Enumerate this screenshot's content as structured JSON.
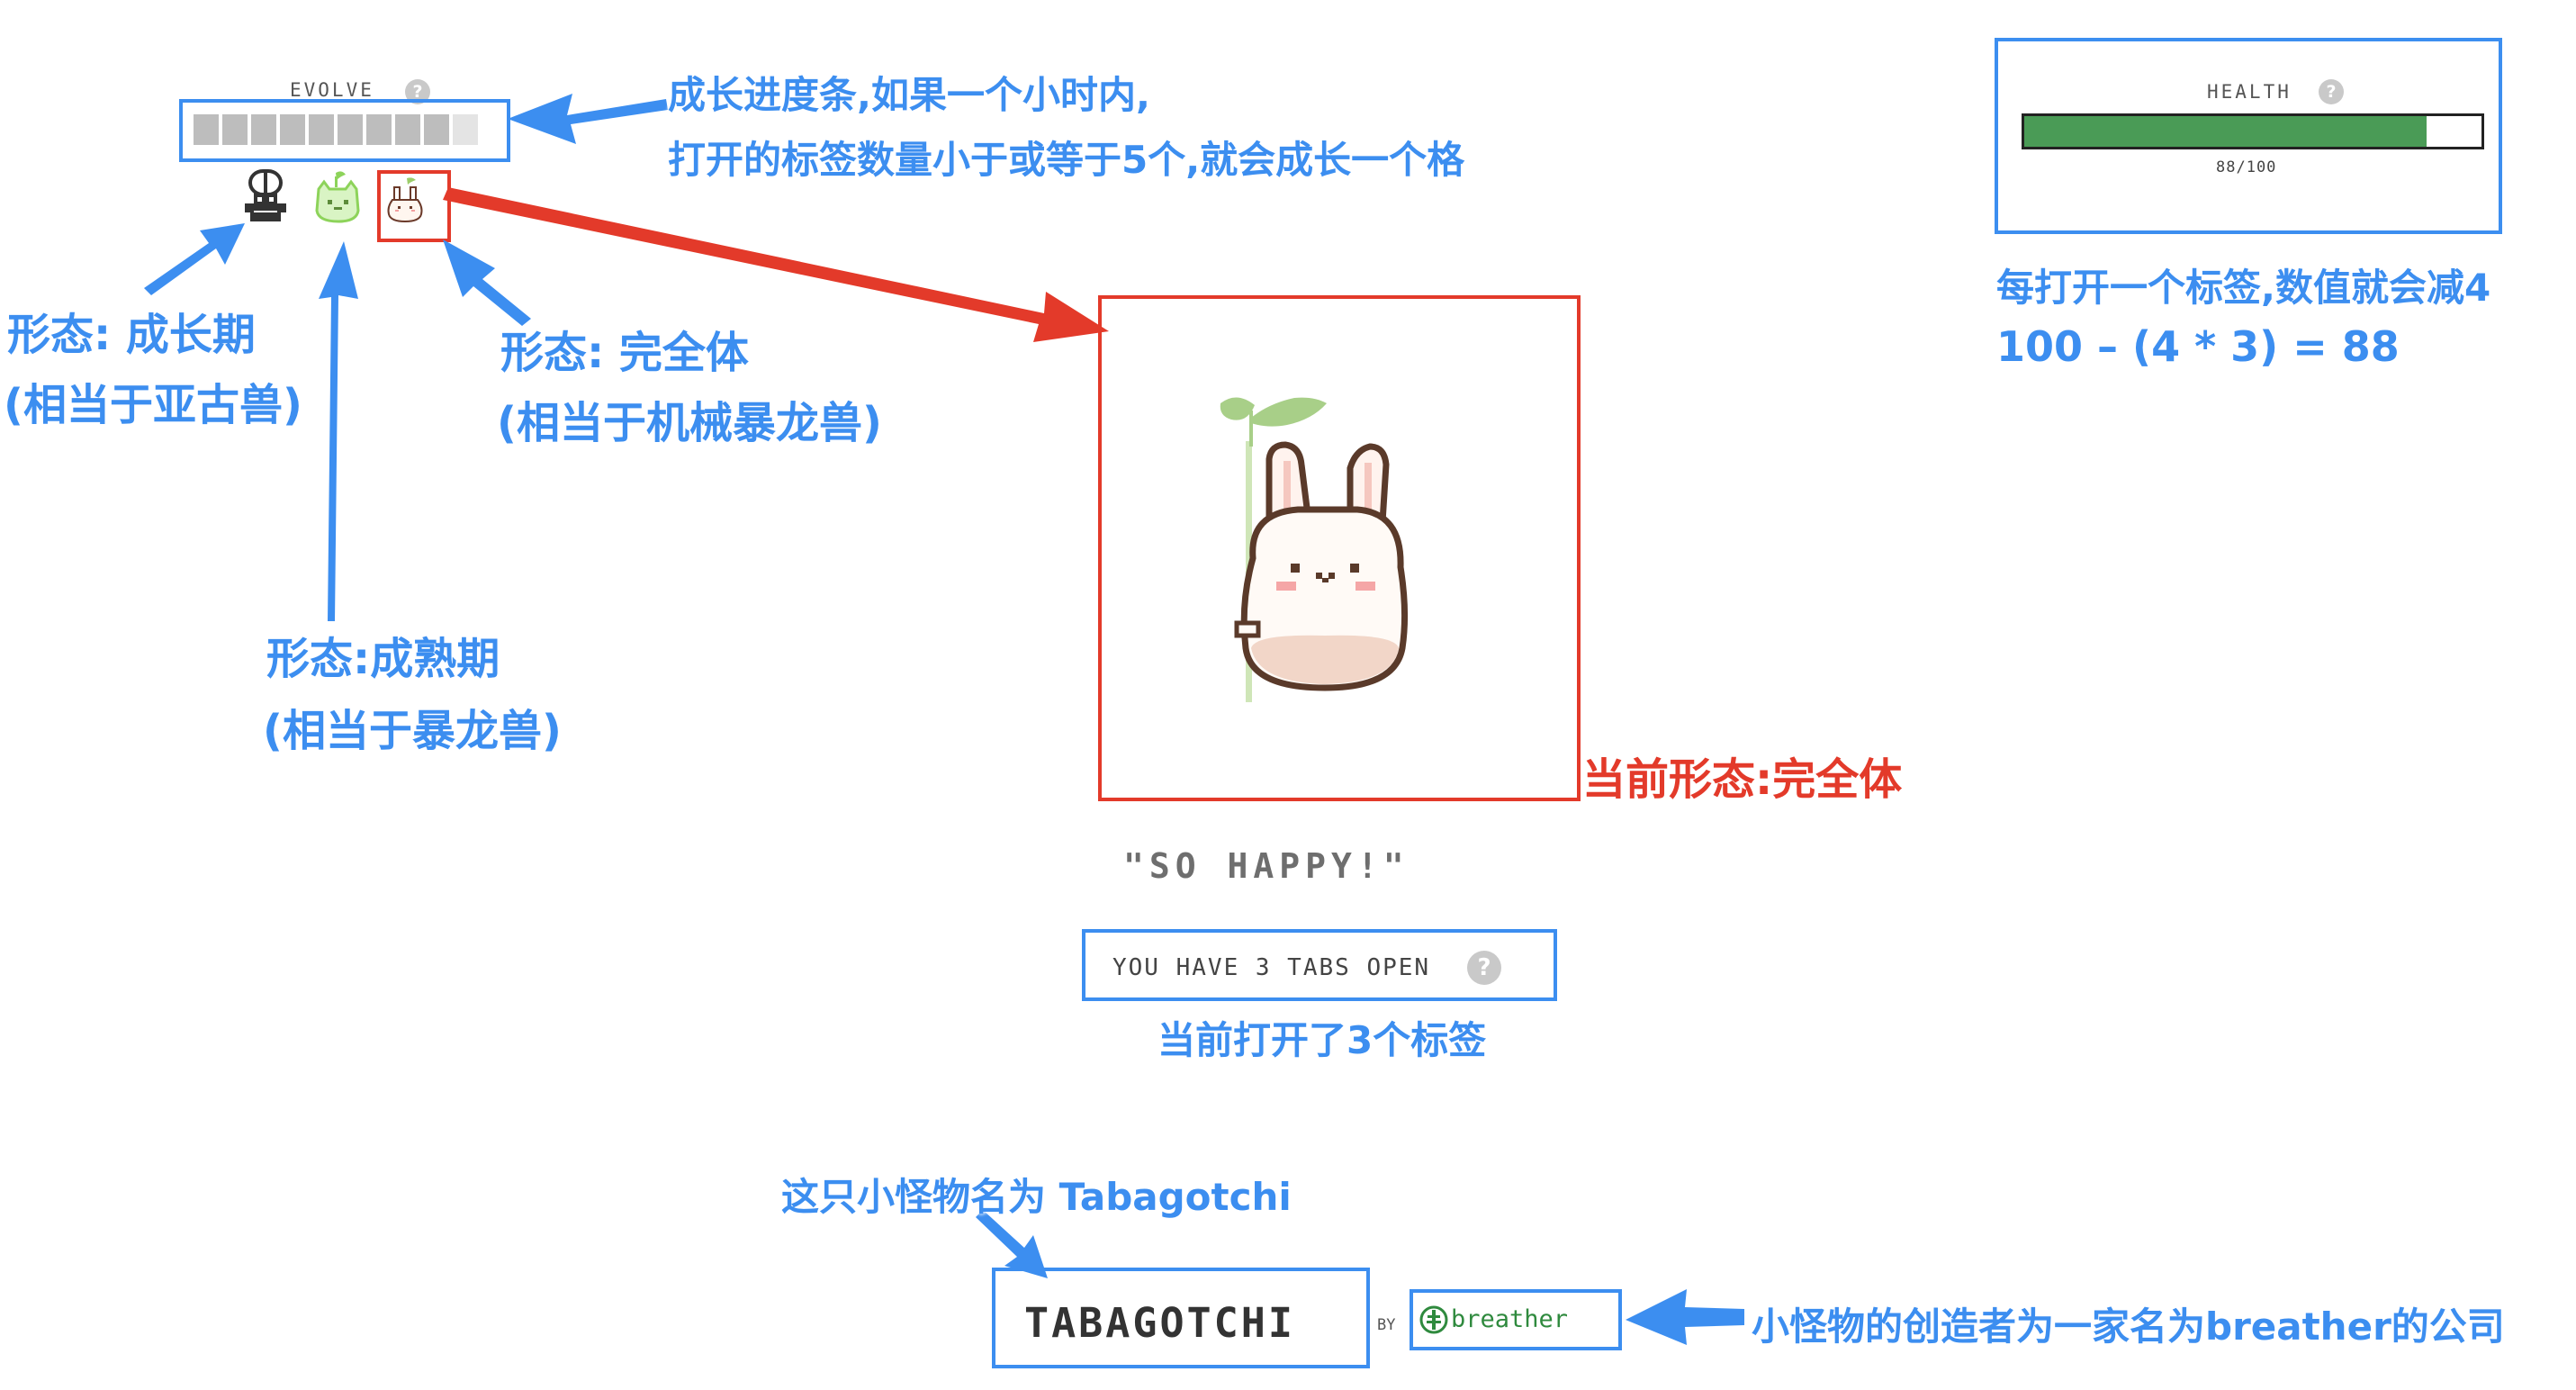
{
  "evolve": {
    "label": "EVOLVE",
    "help": "?",
    "cells_filled": 9,
    "cells_total": 10
  },
  "forms": [
    {
      "name": "growth-stage"
    },
    {
      "name": "mature-stage"
    },
    {
      "name": "perfect-stage"
    }
  ],
  "health": {
    "label": "HEALTH",
    "help": "?",
    "value": 88,
    "max": 100,
    "readout": "88/100",
    "bar_color": "#4a9b56"
  },
  "status": {
    "quote": "\"SO HAPPY!\"",
    "tabs_text": "YOU HAVE 3 TABS OPEN",
    "help": "?"
  },
  "brand": {
    "name": "TABAGOTCHI",
    "by": "BY",
    "company": "breather"
  },
  "annotations": {
    "evolve_line1": "成长进度条,如果一个小时内,",
    "evolve_line2": "打开的标签数量小于或等于5个,就会成长一个格",
    "growth_line1": "形态: 成长期",
    "growth_line2": "(相当于亚古兽)",
    "perfect_line1": "形态: 完全体",
    "perfect_line2": "(相当于机械暴龙兽)",
    "mature_line1": "形态:成熟期",
    "mature_line2": "(相当于暴龙兽)",
    "current_form": "当前形态:完全体",
    "health_line1": "每打开一个标签,数值就会减4",
    "health_line2": "100 – (4 * 3) = 88",
    "tabs_note": "当前打开了3个标签",
    "name_note": "这只小怪物名为 Tabagotchi",
    "company_note": "小怪物的创造者为一家名为breather的公司"
  },
  "colors": {
    "annotation_blue": "#3c8ef0",
    "annotation_red": "#e33a2a",
    "evolve_cell": "#bdbdbd"
  }
}
